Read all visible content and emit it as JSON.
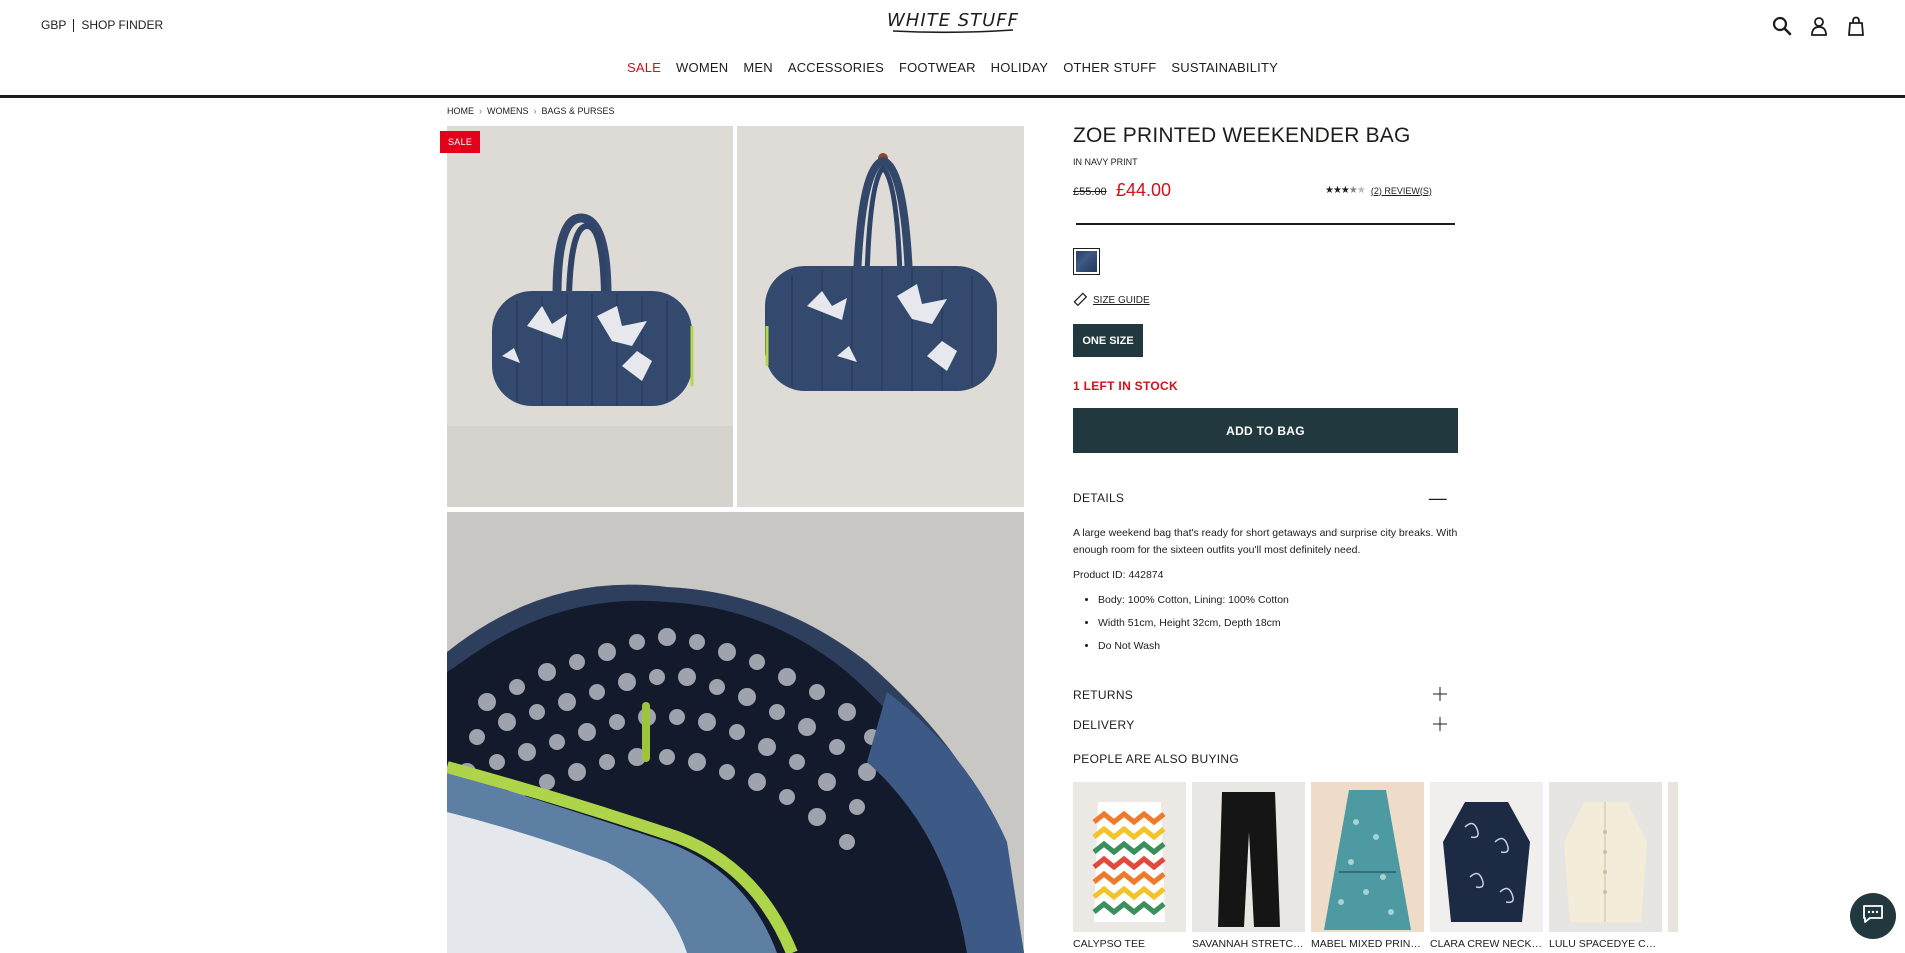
{
  "header": {
    "currency": "GBP",
    "shop_finder": "SHOP FINDER",
    "logo_text": "WHITE STUFF",
    "icons": [
      "search-icon",
      "account-icon",
      "bag-icon"
    ]
  },
  "nav": {
    "items": [
      "SALE",
      "WOMEN",
      "MEN",
      "ACCESSORIES",
      "FOOTWEAR",
      "HOLIDAY",
      "OTHER STUFF",
      "SUSTAINABILITY"
    ]
  },
  "breadcrumb": [
    "HOME",
    "WOMENS",
    "BAGS & PURSES"
  ],
  "gallery": {
    "badge": "SALE"
  },
  "product": {
    "title": "ZOE PRINTED WEEKENDER BAG",
    "colour": "IN NAVY PRINT",
    "old_price": "£55.00",
    "price": "£44.00",
    "rating": 3.5,
    "reviews": "(2) REVIEW(S)",
    "size_guide": "SIZE GUIDE",
    "size": "ONE SIZE",
    "stock": "1 LEFT IN STOCK",
    "add_to_bag": "ADD TO BAG"
  },
  "details": {
    "heading": "DETAILS",
    "description": "A large weekend bag that's ready for short getaways and surprise city breaks. With enough room for the sixteen outfits you'll most definitely need.",
    "product_id": "Product ID: 442874",
    "bullets": [
      "Body: 100% Cotton, Lining: 100% Cotton",
      "Width 51cm, Height 32cm, Depth 18cm",
      "Do Not Wash"
    ]
  },
  "returns": {
    "heading": "RETURNS"
  },
  "delivery": {
    "heading": "DELIVERY"
  },
  "also_buying": {
    "heading": "PEOPLE ARE ALSO BUYING",
    "items": [
      "CALYPSO TEE",
      "SAVANNAH STRETCH...",
      "MABEL MIXED PRINT ...",
      "CLARA CREW NECK ...",
      "LULU SPACEDYE CAR..."
    ]
  },
  "colors": {
    "sale_red": "#d2101b",
    "button_dark": "#22383f"
  }
}
